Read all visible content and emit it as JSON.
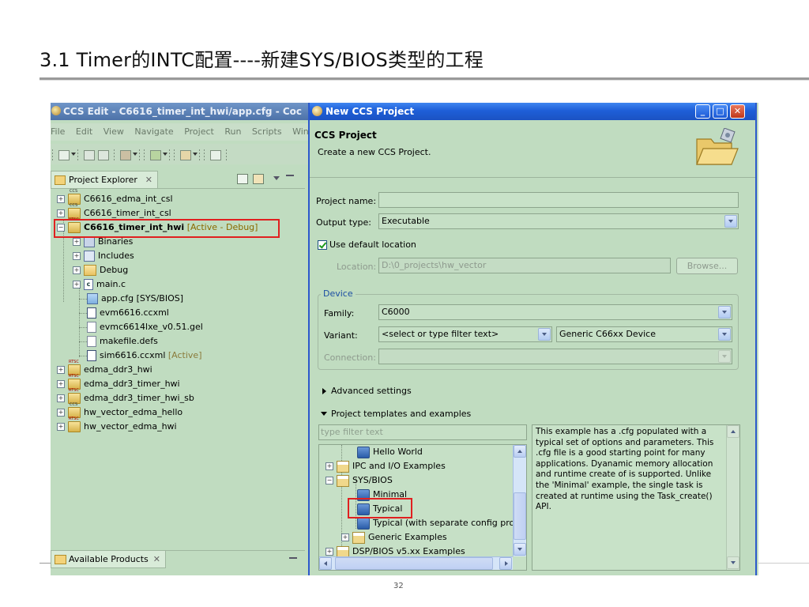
{
  "slide": {
    "title": "3.1 Timer的INTC配置----新建SYS/BIOS类型的工程",
    "page_number": "32"
  },
  "ide": {
    "title": "CCS Edit - C6616_timer_int_hwi/app.cfg - Coc",
    "menu": [
      "File",
      "Edit",
      "View",
      "Navigate",
      "Project",
      "Run",
      "Scripts",
      "Windo"
    ],
    "project_explorer": {
      "tab_label": "Project Explorer",
      "close_glyph": "✕",
      "items": [
        {
          "label": "C6616_edma_int_csl",
          "suffix": ""
        },
        {
          "label": "C6616_timer_int_csl",
          "suffix": ""
        },
        {
          "label": "C6616_timer_int_hwi",
          "suffix": "[Active - Debug]"
        },
        {
          "label": "Binaries",
          "suffix": ""
        },
        {
          "label": "Includes",
          "suffix": ""
        },
        {
          "label": "Debug",
          "suffix": ""
        },
        {
          "label": "main.c",
          "suffix": ""
        },
        {
          "label": "app.cfg [SYS/BIOS]",
          "suffix": ""
        },
        {
          "label": "evm6616.ccxml",
          "suffix": ""
        },
        {
          "label": "evmc6614lxe_v0.51.gel",
          "suffix": ""
        },
        {
          "label": "makefile.defs",
          "suffix": ""
        },
        {
          "label": "sim6616.ccxml",
          "suffix": "[Active]"
        },
        {
          "label": "edma_ddr3_hwi",
          "suffix": ""
        },
        {
          "label": "edma_ddr3_timer_hwi",
          "suffix": ""
        },
        {
          "label": "edma_ddr3_timer_hwi_sb",
          "suffix": ""
        },
        {
          "label": "hw_vector_edma_hello",
          "suffix": ""
        },
        {
          "label": "hw_vector_edma_hwi",
          "suffix": ""
        }
      ]
    },
    "available_products": {
      "tab_label": "Available Products",
      "close_glyph": "✕"
    }
  },
  "dialog": {
    "title": "New CCS Project",
    "window_buttons": {
      "minimize": "_",
      "maximize": "□",
      "close": "✕"
    },
    "header_title": "CCS Project",
    "header_subtitle": "Create a new CCS Project.",
    "project_name_label": "Project name:",
    "project_name_value": "",
    "output_type_label": "Output type:",
    "output_type_value": "Executable",
    "use_default_location_label": "Use default location",
    "use_default_location_checked": true,
    "location_label": "Location:",
    "location_value": "D:\\0_projects\\hw_vector",
    "browse_label": "Browse...",
    "device": {
      "group_title": "Device",
      "family_label": "Family:",
      "family_value": "C6000",
      "variant_label": "Variant:",
      "variant_filter": "<select or type filter text>",
      "variant_value": "Generic C66xx Device",
      "connection_label": "Connection:",
      "connection_value": ""
    },
    "advanced_settings_label": "Advanced settings",
    "templates": {
      "section_label": "Project templates and examples",
      "filter_placeholder": "type filter text",
      "items": [
        {
          "label": "Hello World"
        },
        {
          "label": "IPC and I/O Examples"
        },
        {
          "label": "SYS/BIOS"
        },
        {
          "label": "Minimal"
        },
        {
          "label": "Typical"
        },
        {
          "label": "Typical (with separate config proje"
        },
        {
          "label": "Generic Examples"
        },
        {
          "label": "DSP/BIOS v5.xx Examples"
        }
      ],
      "selected": "Typical",
      "description": "This example has a .cfg populated with a typical set of options and parameters.  This .cfg file is a good starting point for many applications.  Dyanamic memory allocation and runtime create of is supported.  Unlike the 'Minimal' example, the single task is created at runtime using the Task_create() API."
    }
  }
}
